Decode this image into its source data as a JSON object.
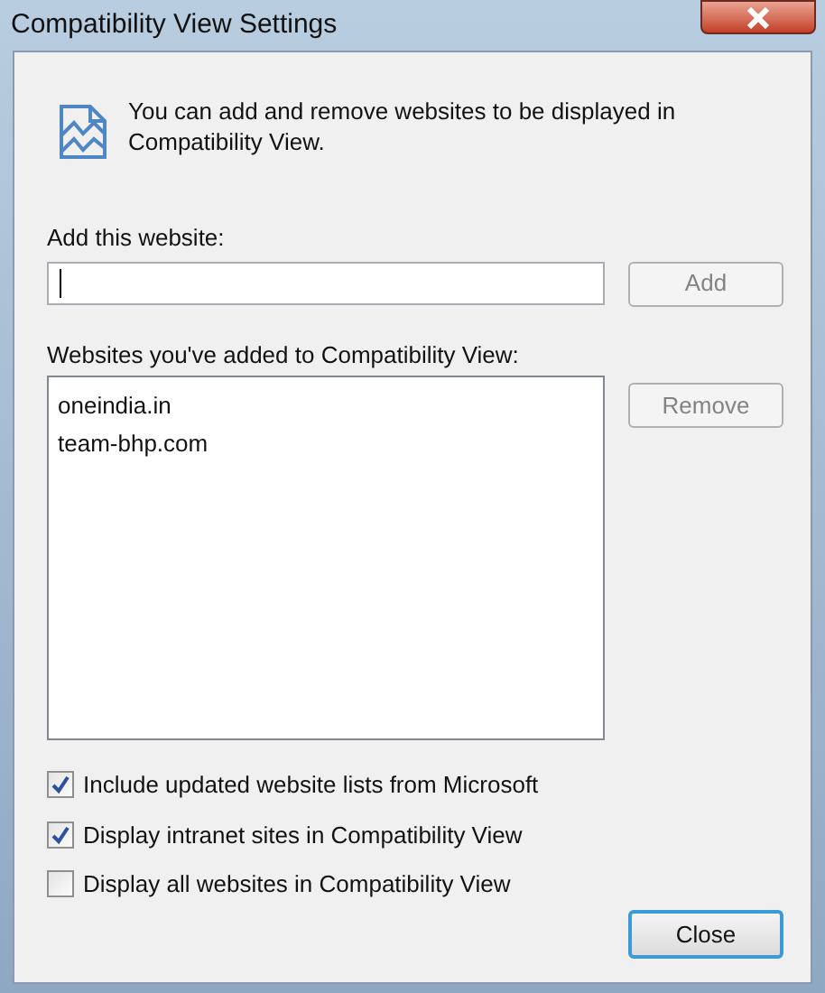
{
  "window": {
    "title": "Compatibility View Settings"
  },
  "intro": "You can add and remove websites to be displayed in Compatibility View.",
  "add_field": {
    "label": "Add this website:"
  },
  "add_button": {
    "label": "Add",
    "disabled": true
  },
  "list": {
    "label": "Websites you've added to Compatibility View:",
    "items": [
      {
        "text": "oneindia.in",
        "selected": false
      },
      {
        "text": "team-bhp.com",
        "selected": false
      }
    ]
  },
  "remove_button": {
    "label": "Remove",
    "disabled": true
  },
  "options": [
    {
      "label": "Include updated website lists from Microsoft",
      "checked": true
    },
    {
      "label": "Display intranet sites in Compatibility View",
      "checked": true
    },
    {
      "label": "Display all websites in Compatibility View",
      "checked": false
    }
  ],
  "close_button": {
    "label": "Close"
  }
}
